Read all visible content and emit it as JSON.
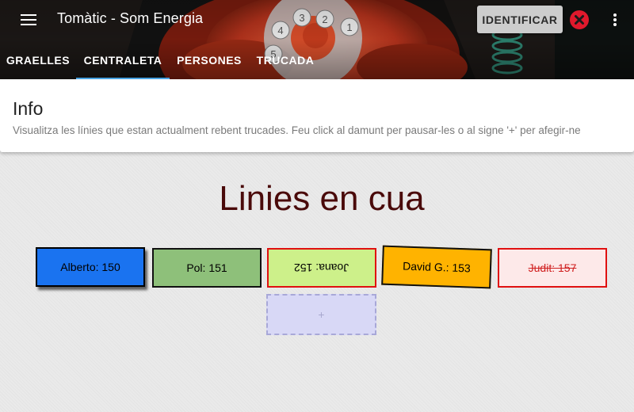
{
  "app": {
    "title": "Tomàtic - Som Energia"
  },
  "header": {
    "identify_label": "IDENTIFICAR",
    "menu_icon": "hamburger-menu-icon",
    "close_icon": "close-circle-icon",
    "more_icon": "more-vertical-icon",
    "dial_numbers": [
      "1",
      "2",
      "3",
      "4",
      "5"
    ]
  },
  "tabs": [
    {
      "label": "GRAELLES",
      "active": false
    },
    {
      "label": "CENTRALETA",
      "active": true
    },
    {
      "label": "PERSONES",
      "active": false
    },
    {
      "label": "TRUCADA",
      "active": false
    }
  ],
  "info": {
    "title": "Info",
    "text": "Visualitza les línies que estan actualment rebent trucades. Feu click al damunt per pausar-les o al signe '+' per afegir-ne"
  },
  "queue": {
    "title": "Linies en cua",
    "lines": [
      {
        "label": "Alberto: 150",
        "color": "#1a73f0",
        "border": "#000000",
        "text_color": "#000000",
        "state": "active"
      },
      {
        "label": "Pol: 151",
        "color": "#8ec07a",
        "border": "#000000",
        "text_color": "#000000",
        "state": "active"
      },
      {
        "label": "Joana: 152",
        "color": "#cdf08a",
        "border": "#e01010",
        "text_color": "#000000",
        "state": "flipped"
      },
      {
        "label": "David G.: 153",
        "color": "#ffb300",
        "border": "#000000",
        "text_color": "#000000",
        "state": "tilted"
      },
      {
        "label": "Judit: 157",
        "color": "#fde9e9",
        "border": "#e01010",
        "text_color": "#d02020",
        "state": "paused"
      }
    ],
    "add_label": "+"
  },
  "colors": {
    "tab_indicator": "#4aa6e8",
    "close_red": "#e0192c",
    "title_text": "#4a0a0a"
  }
}
